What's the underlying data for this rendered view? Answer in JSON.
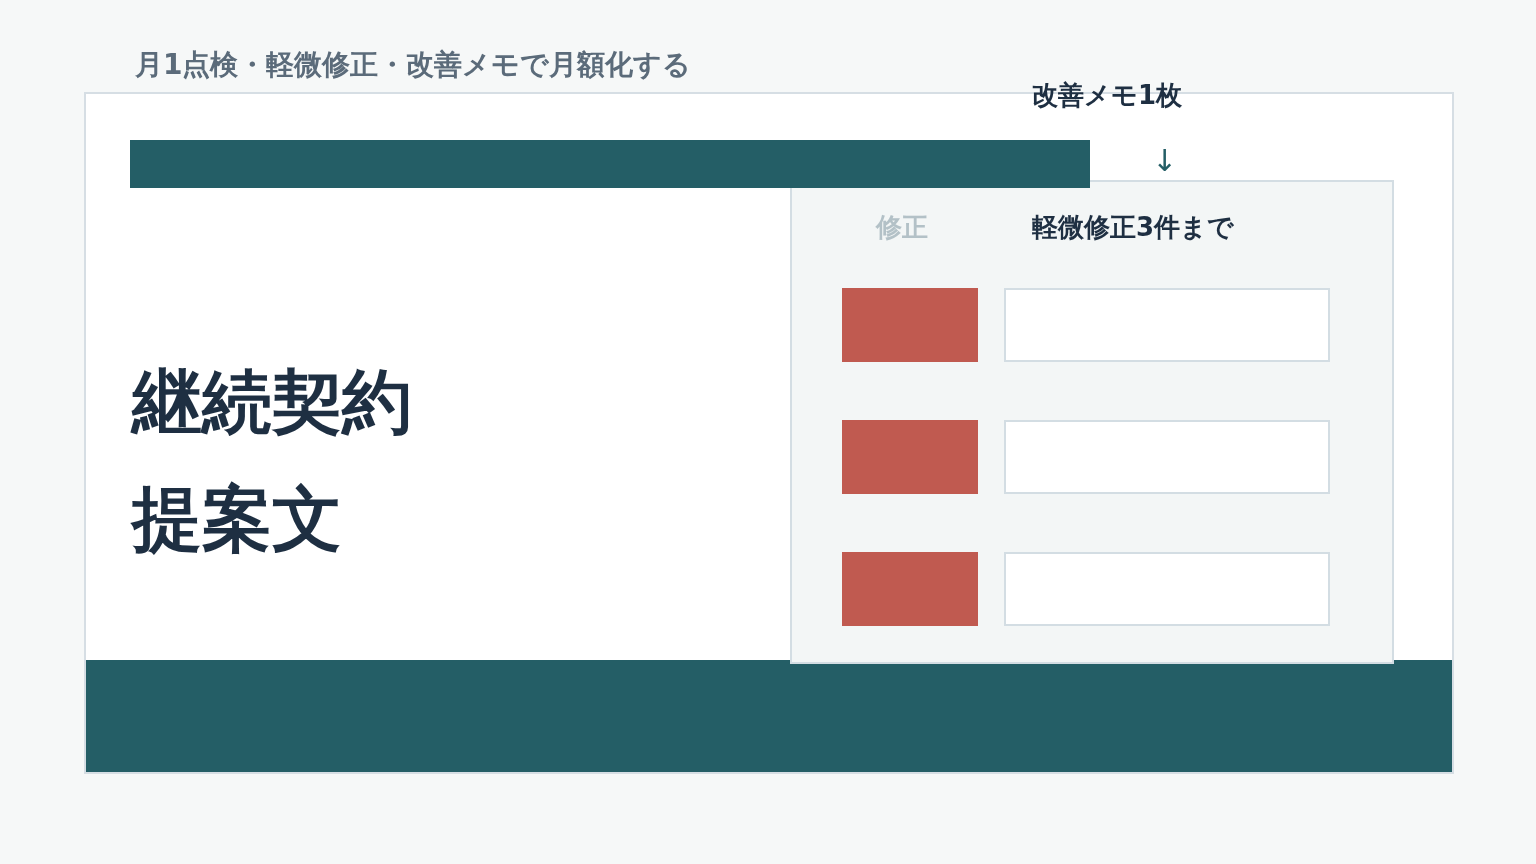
{
  "subtitle": "月1点検・軽微修正・改善メモで月額化する",
  "title_lines": [
    "継続契約",
    "提案文"
  ],
  "flow": [
    {
      "kind": "step",
      "text": "改善メモ1枚"
    },
    {
      "kind": "arrow",
      "text": "↓"
    },
    {
      "kind": "step",
      "label": "修正",
      "text": "軽微修正3件まで"
    }
  ],
  "slots": [
    {
      "kind": "pair"
    },
    {
      "kind": "pair"
    },
    {
      "kind": "pair"
    }
  ]
}
